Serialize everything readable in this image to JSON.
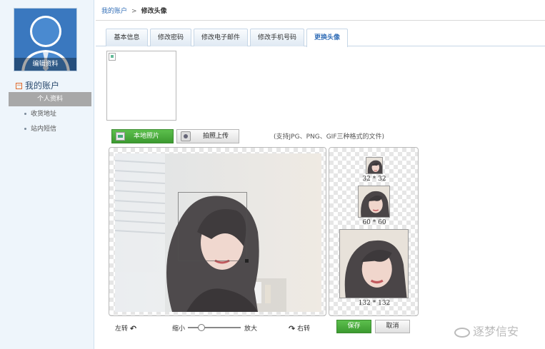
{
  "sidebar": {
    "avatar_edit_label": "编辑资料",
    "account_title": "我的账户",
    "items": [
      {
        "label": "个人资料",
        "active": true
      },
      {
        "label": "收货地址",
        "active": false
      },
      {
        "label": "站内短信",
        "active": false
      }
    ]
  },
  "breadcrumb": {
    "root": "我的账户",
    "separator": ">",
    "current": "修改头像"
  },
  "tabs": [
    {
      "label": "基本信息"
    },
    {
      "label": "修改密码"
    },
    {
      "label": "修改电子邮件"
    },
    {
      "label": "修改手机号码"
    },
    {
      "label": "更换头像",
      "active": true
    }
  ],
  "upload": {
    "local_photo_label": "本地照片",
    "camera_upload_label": "拍照上传",
    "support_text": "(支持JPG、PNG、GIF三种格式的文件)"
  },
  "thumbnails": [
    {
      "label": "32 * 32"
    },
    {
      "label": "60 * 60"
    },
    {
      "label": "132 * 132"
    }
  ],
  "controls": {
    "rotate_left_label": "左转",
    "rotate_right_label": "右转",
    "zoom_out_label": "缩小",
    "zoom_in_label": "放大",
    "zoom_level": 0.25,
    "save_label": "保存",
    "cancel_label": "取消"
  },
  "watermark": "逐梦信安",
  "colors": {
    "accent_blue": "#3570b8",
    "button_green": "#4aaa3c",
    "sidebar_bg": "#eef5fb"
  }
}
